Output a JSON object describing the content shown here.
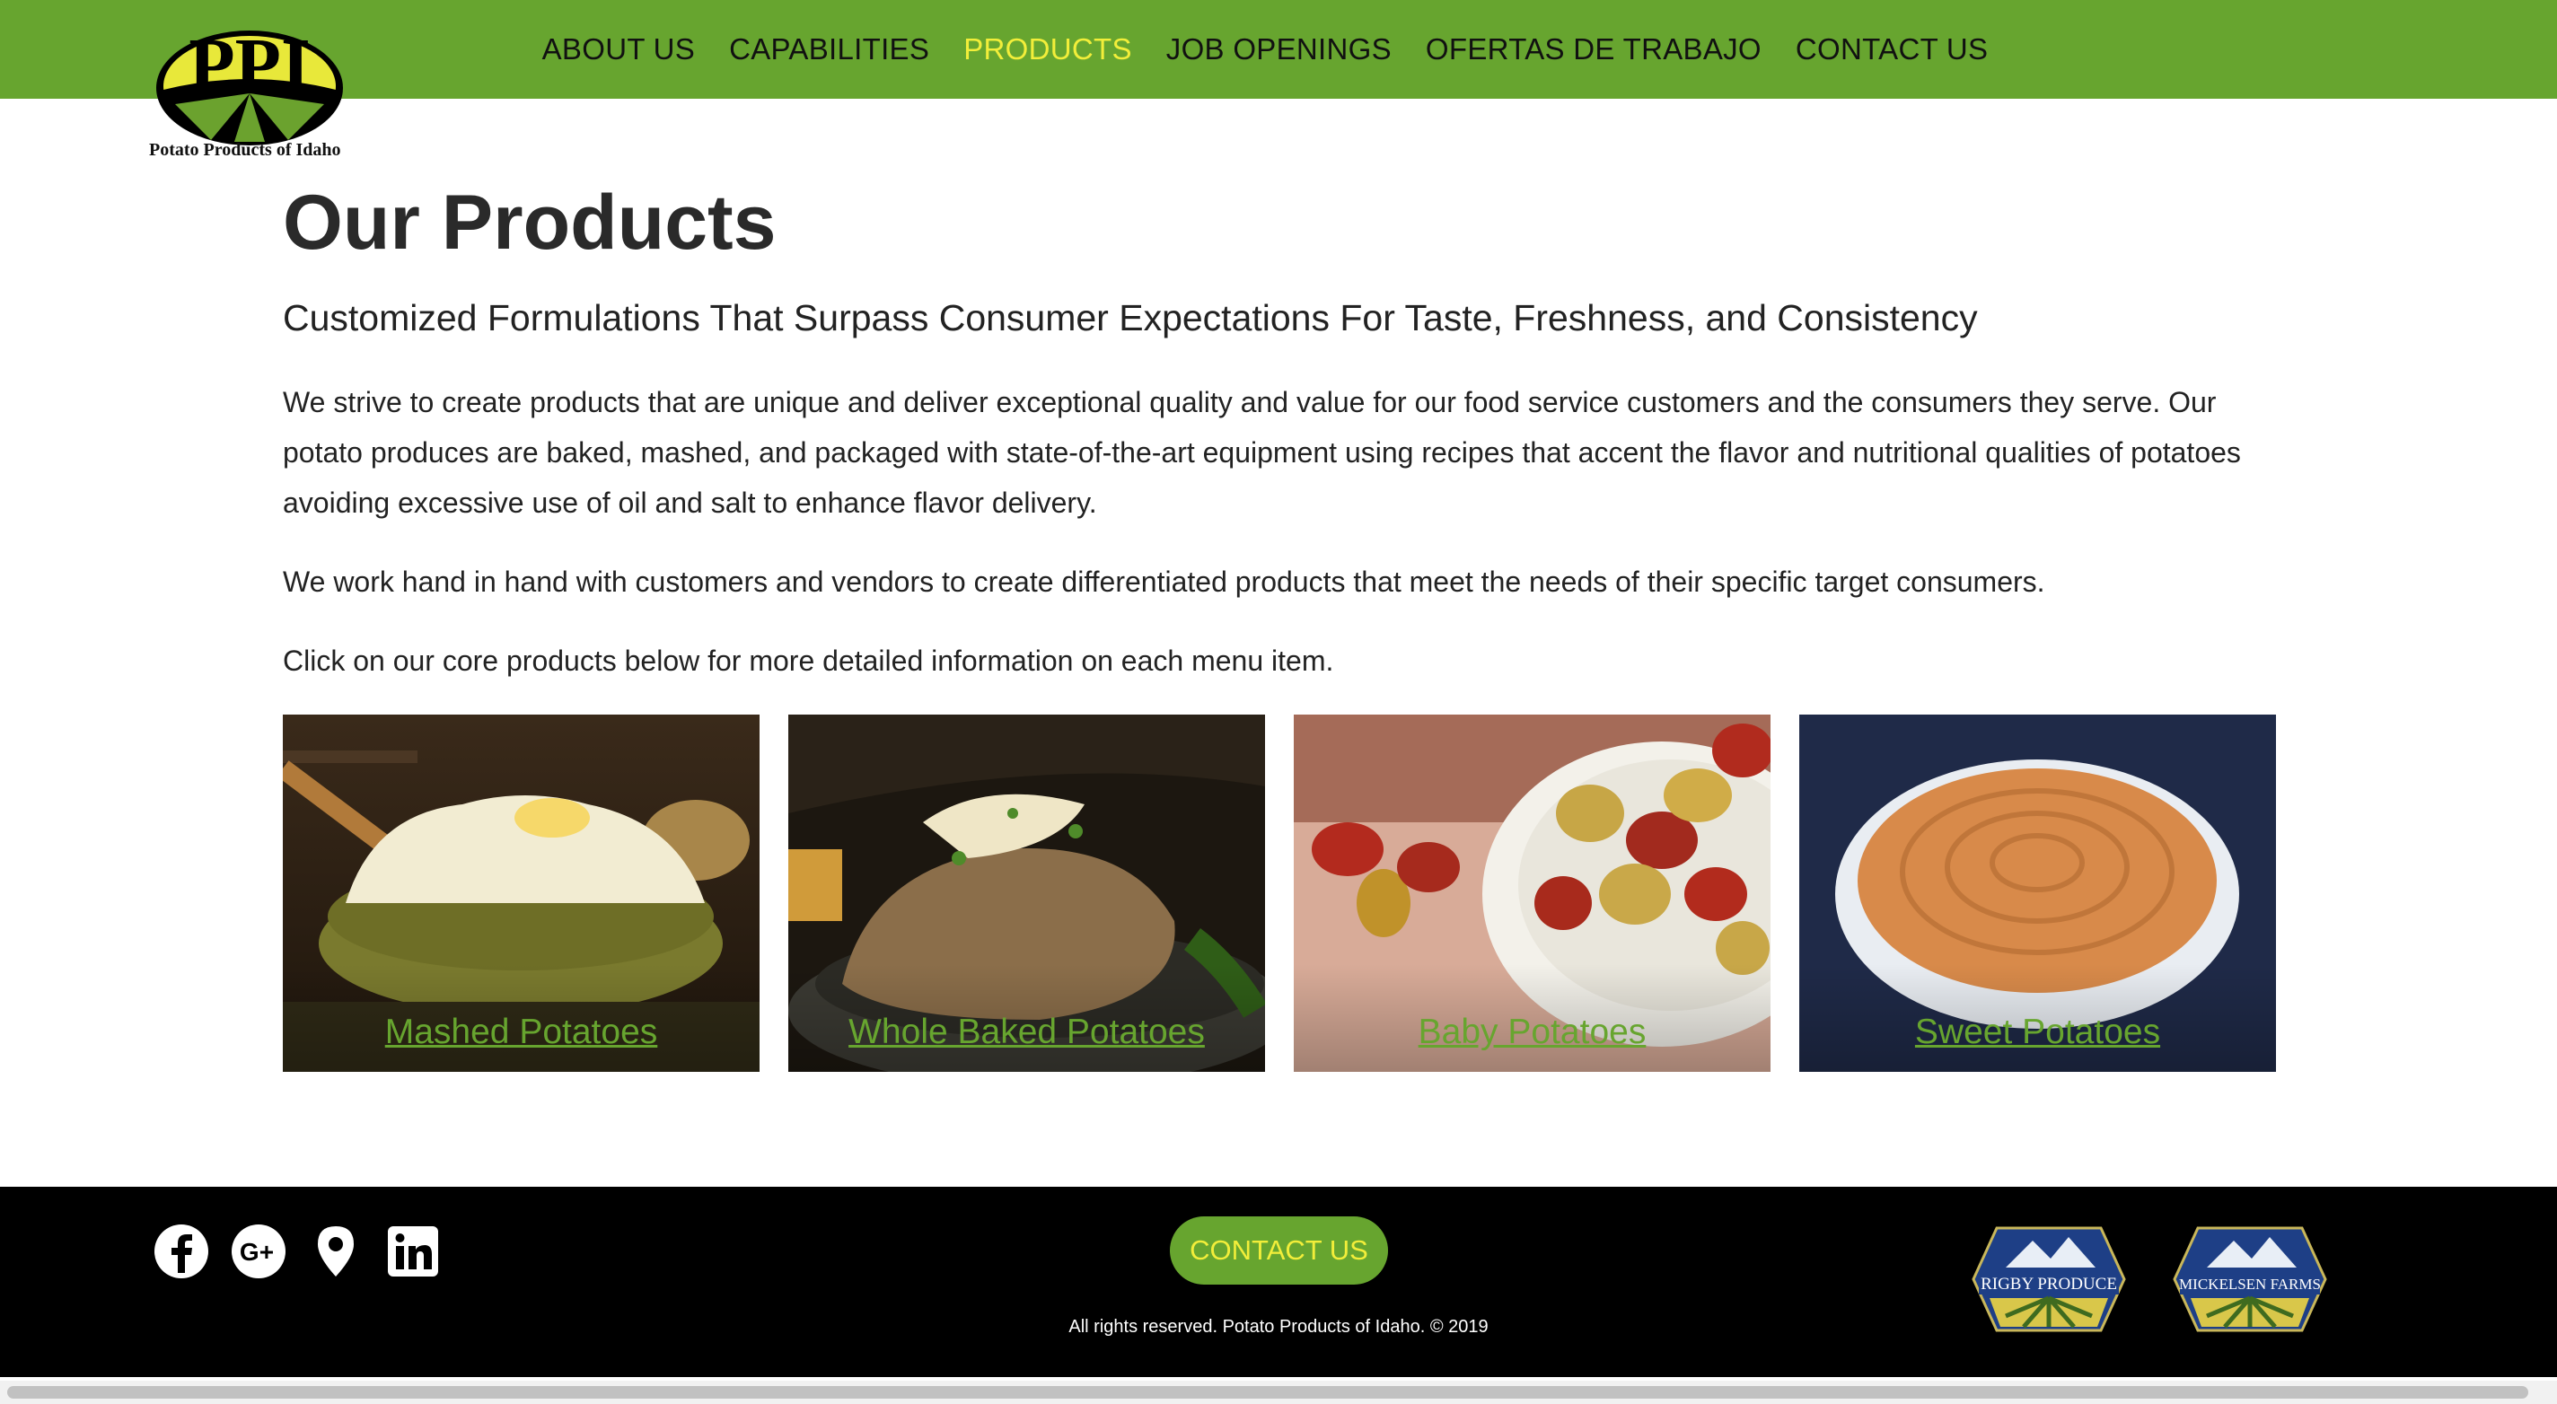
{
  "nav": {
    "items": [
      {
        "label": "ABOUT US",
        "active": false
      },
      {
        "label": "CAPABILITIES",
        "active": false
      },
      {
        "label": "PRODUCTS",
        "active": true
      },
      {
        "label": "JOB OPENINGS",
        "active": false
      },
      {
        "label": "OFERTAS DE TRABAJO",
        "active": false
      },
      {
        "label": "CONTACT US",
        "active": false
      }
    ]
  },
  "logo": {
    "caption": "Potato Products of Idaho",
    "letters": "PPI"
  },
  "main": {
    "title": "Our Products",
    "subtitle": "Customized Formulations That Surpass Consumer Expectations For Taste, Freshness, and Consistency",
    "paragraphs": [
      "We strive to create products that are unique and deliver exceptional quality and value for our food service customers and the consumers they serve. Our potato produces are baked, mashed, and packaged with state-of-the-art equipment using recipes that accent the flavor and nutritional qualities of potatoes avoiding excessive use of oil and salt to enhance flavor delivery.",
      "We work hand in hand with customers and vendors to create differentiated products that meet the needs of their specific target consumers.",
      "Click on our core products below for more detailed information on each menu item."
    ]
  },
  "products": [
    {
      "label": "Mashed Potatoes"
    },
    {
      "label": "Whole Baked Potatoes"
    },
    {
      "label": "Baby Potatoes"
    },
    {
      "label": "Sweet Potatoes"
    }
  ],
  "footer": {
    "social_icons": [
      "facebook-icon",
      "google-plus-icon",
      "location-pin-icon",
      "linkedin-icon"
    ],
    "cta_label": "CONTACT US",
    "copyright": "All rights reserved. Potato Products of Idaho. © 2019",
    "badges": [
      {
        "text": "RIGBY PRODUCE"
      },
      {
        "text": "MICKELSEN FARMS"
      }
    ]
  },
  "colors": {
    "brand_green": "#67a52f",
    "accent_yellow": "#f2ee3a",
    "footer_bg": "#000000"
  }
}
